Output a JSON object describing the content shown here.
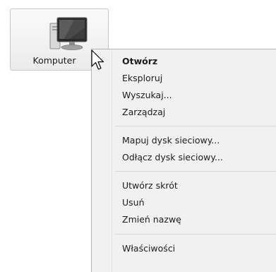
{
  "desktop": {
    "icon": {
      "name": "computer-icon",
      "label": "Komputer"
    }
  },
  "cursor": {
    "icon": "arrow-cursor-icon"
  },
  "context_menu": {
    "items": [
      {
        "label": "Otwórz",
        "bold": true
      },
      {
        "label": "Eksploruj"
      },
      {
        "label": "Wyszukaj..."
      },
      {
        "label": "Zarządzaj"
      },
      {
        "label": "Mapuj dysk sieciowy..."
      },
      {
        "label": "Odłącz dysk sieciowy..."
      },
      {
        "label": "Utwórz skrót"
      },
      {
        "label": "Usuń"
      },
      {
        "label": "Zmień nazwę"
      },
      {
        "label": "Właściwości"
      }
    ]
  }
}
